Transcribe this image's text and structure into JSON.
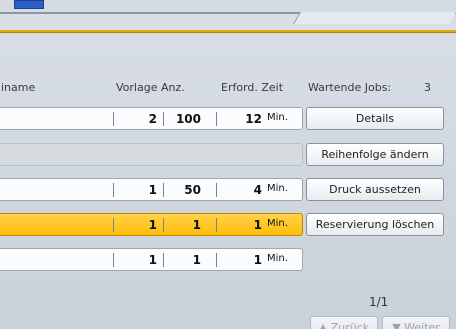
{
  "header": {
    "col_name": "iname",
    "col_originals_qty": "Vorlage Anz.",
    "col_required_time": "Erford. Zeit",
    "waiting_jobs_label": "Wartende Jobs:",
    "waiting_jobs_count": "3"
  },
  "rows": [
    {
      "originals": "2",
      "qty": "100",
      "time": "12",
      "unit": "Min."
    },
    {
      "originals": "1",
      "qty": "50",
      "time": "4",
      "unit": "Min."
    },
    {
      "originals": "1",
      "qty": "1",
      "time": "1",
      "unit": "Min."
    },
    {
      "originals": "1",
      "qty": "1",
      "time": "1",
      "unit": "Min."
    }
  ],
  "buttons": {
    "details": "Details",
    "change_order": "Reihenfolge ändern",
    "suspend_print": "Druck aussetzen",
    "delete_reservation": "Reservierung löschen",
    "prev": "▲ Zurück",
    "next": "▼ Weiter"
  },
  "pagination": {
    "indicator": "1/1"
  },
  "colors": {
    "accent": "#e4a716",
    "selected_row": "#ffc41d"
  }
}
